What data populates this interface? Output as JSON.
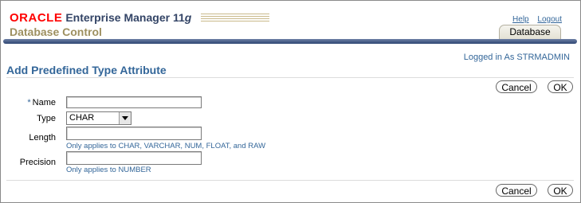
{
  "header": {
    "brand": "ORACLE",
    "product": "Enterprise Manager 11",
    "version": "g",
    "subtitle": "Database Control",
    "links": {
      "help": "Help",
      "logout": "Logout"
    },
    "tab": "Database",
    "logged_in": "Logged in As STRMADMIN"
  },
  "page": {
    "title": "Add Predefined Type Attribute",
    "cancel_label": "Cancel",
    "ok_label": "OK"
  },
  "form": {
    "name": {
      "label": "Name",
      "required_mark": "*",
      "value": ""
    },
    "type": {
      "label": "Type",
      "value": "CHAR"
    },
    "length": {
      "label": "Length",
      "value": "",
      "hint": "Only applies to CHAR, VARCHAR, NUM, FLOAT, and RAW"
    },
    "precision": {
      "label": "Precision",
      "value": "",
      "hint": "Only applies to NUMBER"
    }
  }
}
